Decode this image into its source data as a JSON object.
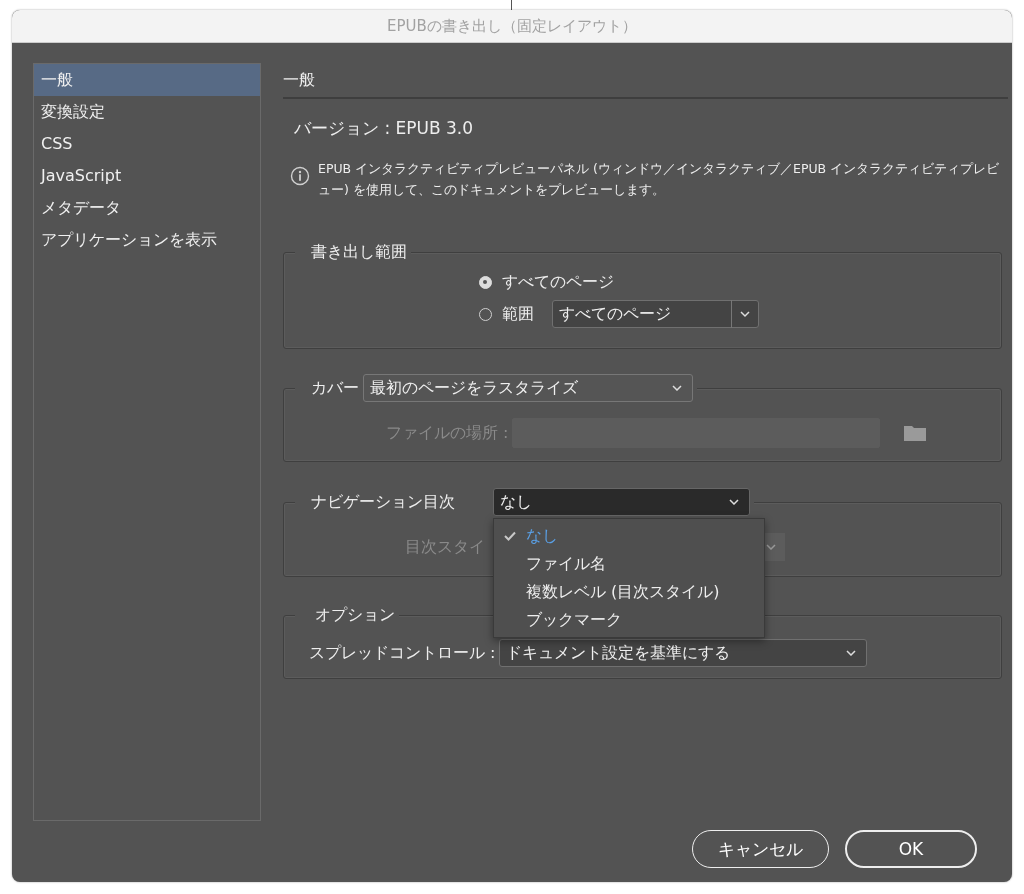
{
  "window": {
    "title": "EPUBの書き出し（固定レイアウト）"
  },
  "sidebar": {
    "items": [
      {
        "label": "一般",
        "selected": true
      },
      {
        "label": "変換設定",
        "selected": false
      },
      {
        "label": "CSS",
        "selected": false
      },
      {
        "label": "JavaScript",
        "selected": false
      },
      {
        "label": "メタデータ",
        "selected": false
      },
      {
        "label": "アプリケーションを表示",
        "selected": false
      }
    ]
  },
  "panel": {
    "heading": "一般",
    "version": "バージョン : EPUB 3.0",
    "info": "EPUB インタラクティビティプレビューパネル (ウィンドウ／インタラクティブ／EPUB インタラクティビティプレビュー) を使用して、このドキュメントをプレビューします。",
    "export_range": {
      "legend": "書き出し範囲",
      "options": [
        {
          "label": "すべてのページ",
          "selected": true
        },
        {
          "label": "範囲",
          "selected": false
        }
      ],
      "range_select": {
        "value": "すべてのページ"
      }
    },
    "cover": {
      "label": "カバー",
      "select": {
        "value": "最初のページをラスタライズ"
      },
      "file_location": {
        "label": "ファイルの場所 :",
        "disabled": true
      }
    },
    "navigation": {
      "label": "ナビゲーション目次",
      "select": {
        "value": "なし",
        "expanded": true
      },
      "menu": [
        {
          "label": "なし",
          "selected": true
        },
        {
          "label": "ファイル名",
          "selected": false
        },
        {
          "label": "複数レベル (目次スタイル)",
          "selected": false
        },
        {
          "label": "ブックマーク",
          "selected": false
        }
      ],
      "toc_style": {
        "label": "目次スタイ",
        "disabled": true
      }
    },
    "options": {
      "legend": "オプション",
      "spread_control": {
        "label": "スプレッドコントロール :",
        "value": "ドキュメント設定を基準にする"
      }
    }
  },
  "buttons": [
    {
      "label": "キャンセル",
      "kind": "secondary"
    },
    {
      "label": "OK",
      "kind": "default"
    }
  ]
}
